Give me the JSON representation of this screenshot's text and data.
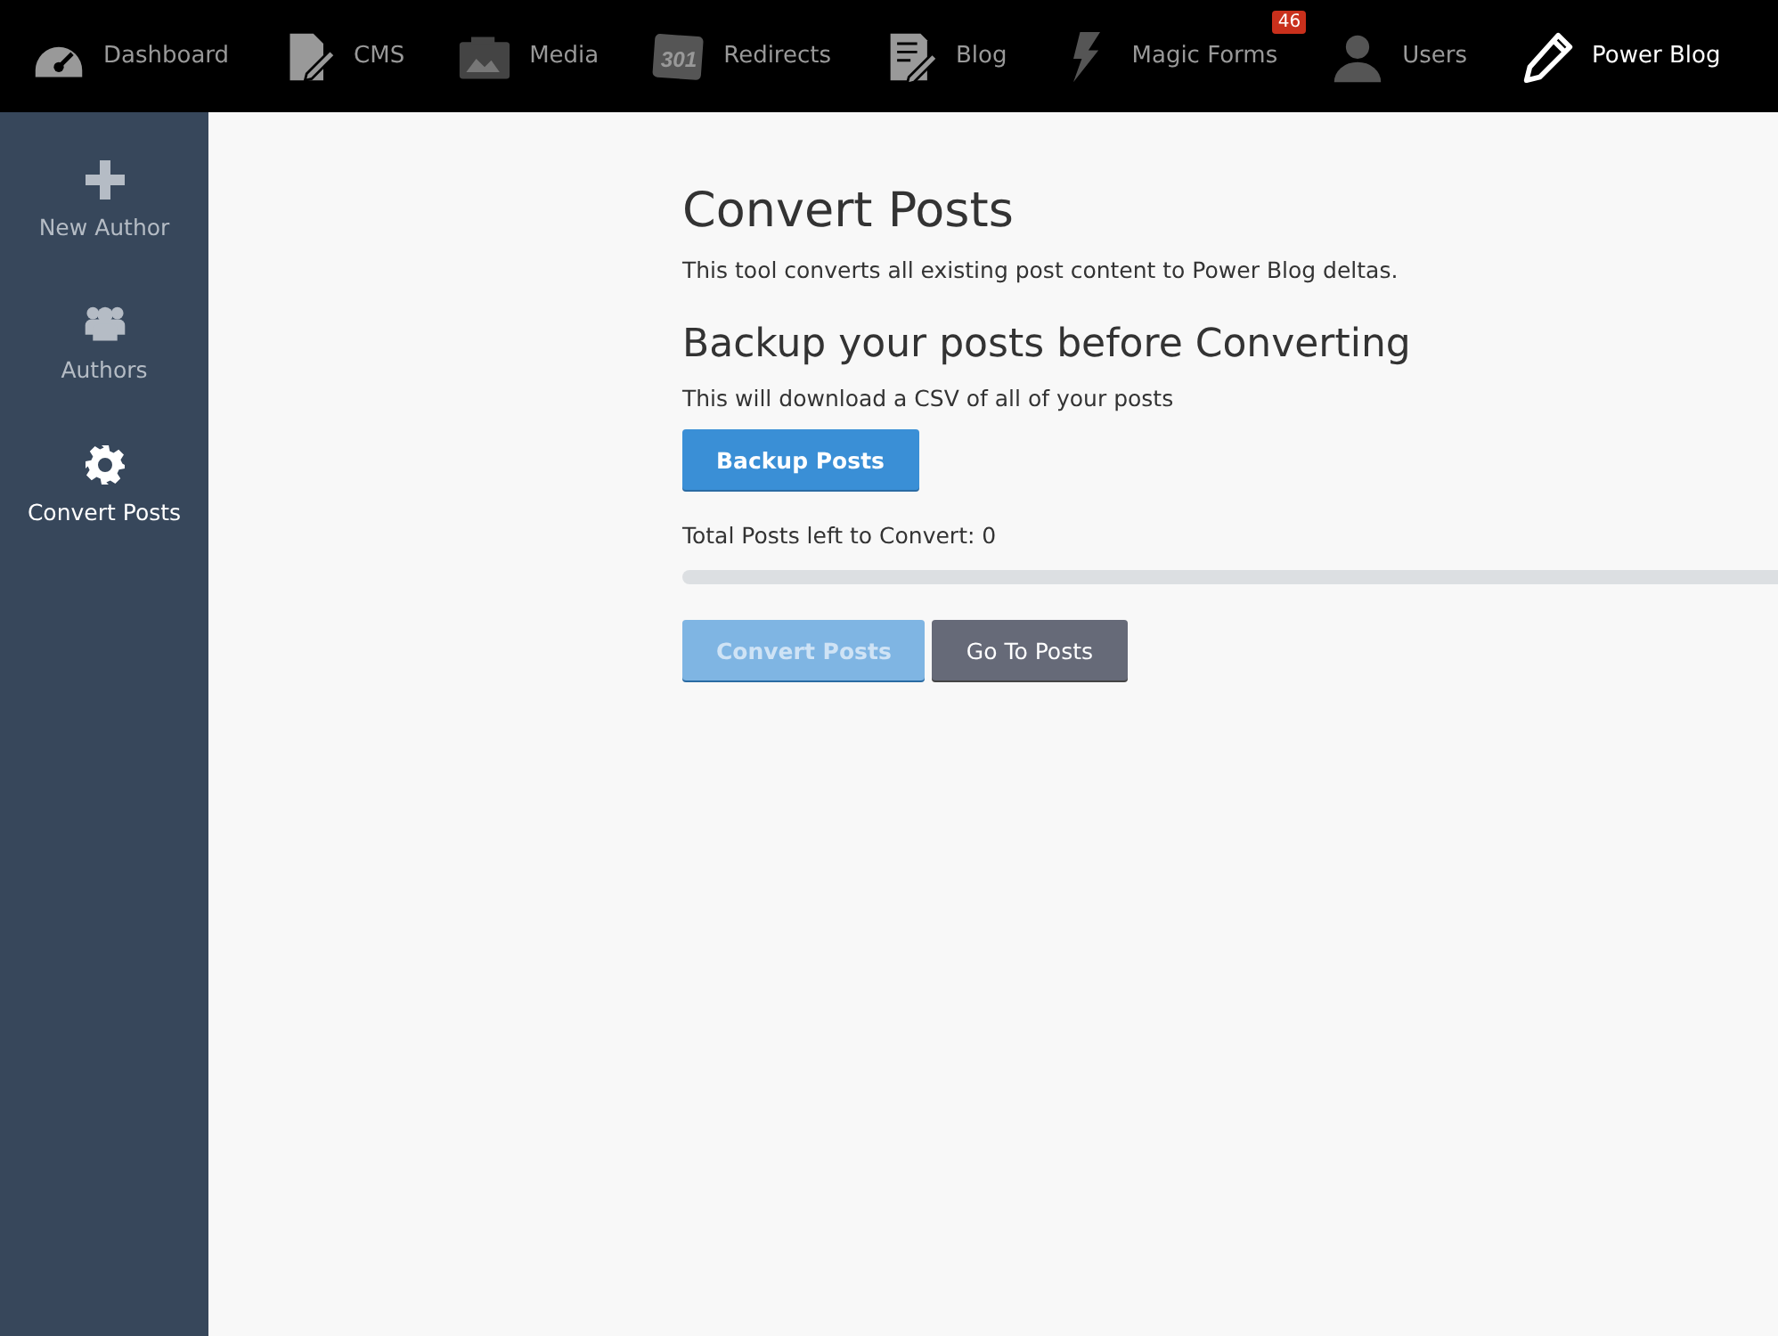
{
  "top_nav": [
    {
      "kind": "gauge",
      "label": "Dashboard",
      "selected": false
    },
    {
      "kind": "cms",
      "label": "CMS",
      "selected": false
    },
    {
      "kind": "camera",
      "label": "Media",
      "selected": false
    },
    {
      "kind": "redirect",
      "label": "Redirects",
      "icon_text": "301",
      "selected": false
    },
    {
      "kind": "document",
      "label": "Blog",
      "selected": false
    },
    {
      "kind": "bolt",
      "label": "Magic Forms",
      "badge": "46",
      "selected": false
    },
    {
      "kind": "person",
      "label": "Users",
      "selected": false
    },
    {
      "kind": "pencil",
      "label": "Power Blog",
      "selected": true
    }
  ],
  "sidebar": {
    "items": [
      {
        "kind": "plus",
        "label": "New Author",
        "selected": false
      },
      {
        "kind": "group",
        "label": "Authors",
        "selected": false
      },
      {
        "kind": "gear",
        "label": "Convert Posts",
        "selected": true
      }
    ]
  },
  "main": {
    "title": "Convert Posts",
    "intro": "This tool converts all existing post content to Power Blog deltas.",
    "backup_heading": "Backup your posts before Converting",
    "backup_text": "This will download a CSV of all of your posts",
    "backup_button": "Backup Posts",
    "remaining": "Total Posts left to Convert: 0",
    "progress": {
      "level": 0
    },
    "buttons": [
      {
        "kind": "primary",
        "label": "Convert Posts",
        "disabled": true
      },
      {
        "kind": "secondary",
        "label": "Go To Posts",
        "disabled": false
      }
    ]
  }
}
